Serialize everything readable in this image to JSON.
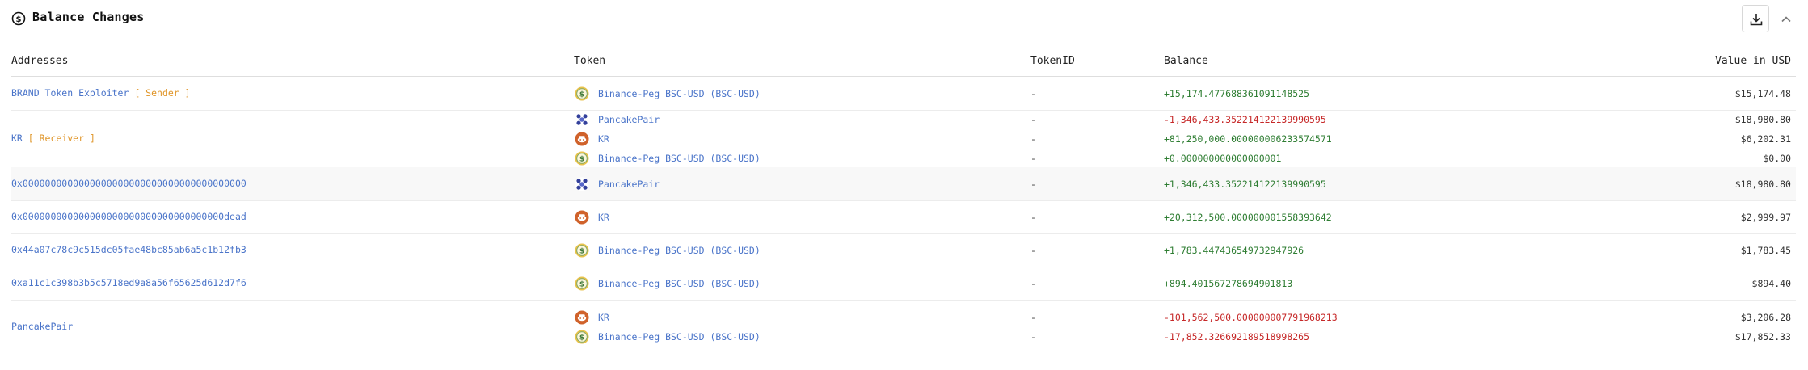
{
  "header": {
    "title": "Balance Changes",
    "title_icon": "dollar-circle-icon",
    "download_icon": "download-icon",
    "collapse_icon": "chevron-up-icon"
  },
  "columns": {
    "addresses": "Addresses",
    "token": "Token",
    "token_id": "TokenID",
    "balance": "Balance",
    "value_usd": "Value in USD"
  },
  "colors": {
    "link": "#4a74c9",
    "tag": "#e0962a",
    "positive": "#2e7d32",
    "negative": "#c62828",
    "usd_token": "#d9b13b",
    "pancake_token": "#3b4aa0",
    "kr_token": "#d0622b"
  },
  "rows": [
    {
      "address": "BRAND Token Exploiter",
      "tag": "[ Sender ]",
      "tokens": [
        {
          "icon": "usd-coin-icon",
          "name": "Binance-Peg BSC-USD (BSC-USD)",
          "token_id": "-",
          "balance": "+15,174.477688361091148525",
          "usd": "$15,174.48"
        }
      ]
    },
    {
      "address": "KR",
      "tag": "[ Receiver ]",
      "tokens": [
        {
          "icon": "pancake-pair-icon",
          "name": "PancakePair",
          "token_id": "-",
          "balance": "-1,346,433.352214122139990595",
          "usd": "$18,980.80"
        },
        {
          "icon": "kr-token-icon",
          "name": "KR",
          "token_id": "-",
          "balance": "+81,250,000.000000006233574571",
          "usd": "$6,202.31"
        },
        {
          "icon": "usd-coin-icon",
          "name": "Binance-Peg BSC-USD (BSC-USD)",
          "token_id": "-",
          "balance": "+0.000000000000000001",
          "usd": "$0.00"
        }
      ]
    },
    {
      "address": "0x0000000000000000000000000000000000000000",
      "tag": "",
      "tokens": [
        {
          "icon": "pancake-pair-icon",
          "name": "PancakePair",
          "token_id": "-",
          "balance": "+1,346,433.352214122139990595",
          "usd": "$18,980.80"
        }
      ]
    },
    {
      "address": "0x000000000000000000000000000000000000dead",
      "tag": "",
      "tokens": [
        {
          "icon": "kr-token-icon",
          "name": "KR",
          "token_id": "-",
          "balance": "+20,312,500.000000001558393642",
          "usd": "$2,999.97"
        }
      ]
    },
    {
      "address": "0x44a07c78c9c515dc05fae48bc85ab6a5c1b12fb3",
      "tag": "",
      "tokens": [
        {
          "icon": "usd-coin-icon",
          "name": "Binance-Peg BSC-USD (BSC-USD)",
          "token_id": "-",
          "balance": "+1,783.447436549732947926",
          "usd": "$1,783.45"
        }
      ]
    },
    {
      "address": "0xa11c1c398b3b5c5718ed9a8a56f65625d612d7f6",
      "tag": "",
      "tokens": [
        {
          "icon": "usd-coin-icon",
          "name": "Binance-Peg BSC-USD (BSC-USD)",
          "token_id": "-",
          "balance": "+894.401567278694901813",
          "usd": "$894.40"
        }
      ]
    },
    {
      "address": "PancakePair",
      "tag": "",
      "tokens": [
        {
          "icon": "kr-token-icon",
          "name": "KR",
          "token_id": "-",
          "balance": "-101,562,500.000000007791968213",
          "usd": "$3,206.28"
        },
        {
          "icon": "usd-coin-icon",
          "name": "Binance-Peg BSC-USD (BSC-USD)",
          "token_id": "-",
          "balance": "-17,852.326692189518998265",
          "usd": "$17,852.33"
        }
      ]
    }
  ]
}
